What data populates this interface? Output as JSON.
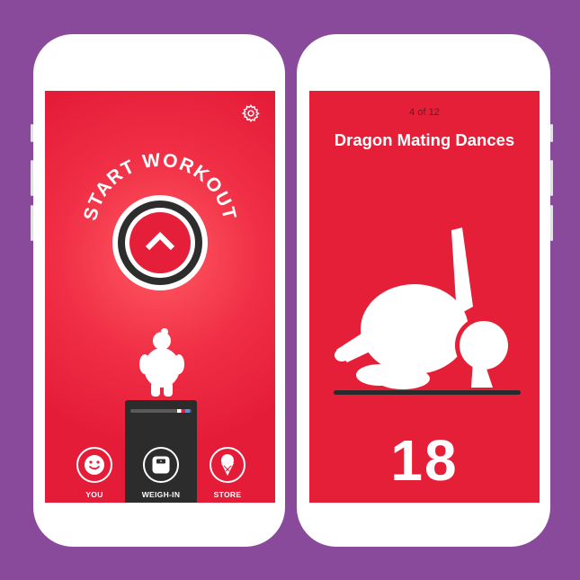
{
  "left_screen": {
    "start_label": "START WORKOUT",
    "nav": [
      {
        "label": "YOU",
        "icon": "smiley-face-icon"
      },
      {
        "label": "WEIGH-IN",
        "icon": "scale-icon"
      },
      {
        "label": "STORE",
        "icon": "ice-cream-icon"
      }
    ]
  },
  "right_screen": {
    "counter": "4 of 12",
    "exercise_title": "Dragon Mating Dances",
    "reps": "18"
  },
  "colors": {
    "background": "#8a4a9c",
    "brand_red": "#e51f3a",
    "dark": "#2d2d2d",
    "white": "#ffffff"
  }
}
